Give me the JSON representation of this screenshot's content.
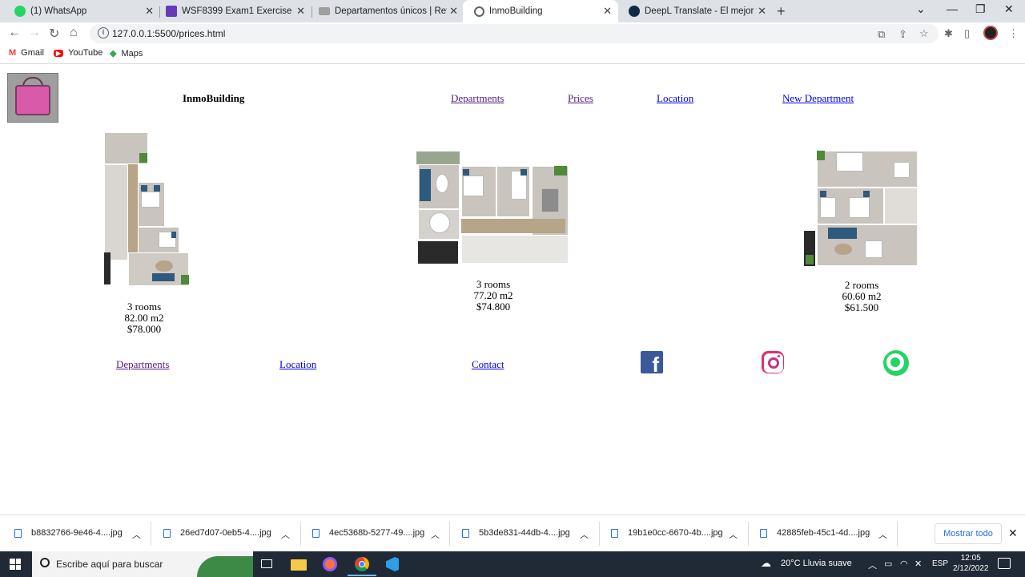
{
  "browser": {
    "tabs": [
      {
        "title": "(1) WhatsApp",
        "favicon": "whatsapp-favicon",
        "color": "#25d366",
        "active": false
      },
      {
        "title": "WSF8399 Exam1 Exercise",
        "favicon": "forms-favicon",
        "color": "#673ab7",
        "active": false
      },
      {
        "title": "Departamentos únicos | Retamo",
        "favicon": "site-favicon",
        "color": "#9e9e9e",
        "active": false
      },
      {
        "title": "InmoBuilding",
        "favicon": "globe-favicon",
        "color": "#5f6368",
        "active": true
      },
      {
        "title": "DeepL Translate - El mejor tradu",
        "favicon": "deepl-favicon",
        "color": "#0f2b46",
        "active": false
      }
    ],
    "url": "127.0.0.1:5500/prices.html",
    "bookmarks": [
      "Gmail",
      "YouTube",
      "Maps"
    ]
  },
  "page": {
    "brand": "InmoBuilding",
    "nav": [
      {
        "label": "Departments",
        "visited": true
      },
      {
        "label": "Prices",
        "visited": true
      },
      {
        "label": "Location",
        "visited": false
      },
      {
        "label": "New Department",
        "visited": false
      }
    ],
    "apartments": [
      {
        "rooms": "3 rooms",
        "area": "82.00 m2",
        "price": "$78.000"
      },
      {
        "rooms": "3 rooms",
        "area": "77.20 m2",
        "price": "$74.800"
      },
      {
        "rooms": "2 rooms",
        "area": "60.60 m2",
        "price": "$61.500"
      }
    ],
    "footer_links": [
      {
        "label": "Departments",
        "visited": true
      },
      {
        "label": "Location",
        "visited": false
      },
      {
        "label": "Contact",
        "visited": false
      }
    ],
    "social": [
      "facebook-icon",
      "instagram-icon",
      "whatsapp-icon"
    ]
  },
  "downloads": {
    "files": [
      "b8832766-9e46-4....jpg",
      "26ed7d07-0eb5-4....jpg",
      "4ec5368b-5277-49....jpg",
      "5b3de831-44db-4....jpg",
      "19b1e0cc-6670-4b....jpg",
      "42885feb-45c1-4d....jpg"
    ],
    "show_all": "Mostrar todo"
  },
  "taskbar": {
    "search_placeholder": "Escribe aquí para buscar",
    "weather": "20°C  Lluvia suave",
    "language": "ESP",
    "time": "12:05",
    "date": "2/12/2022"
  }
}
